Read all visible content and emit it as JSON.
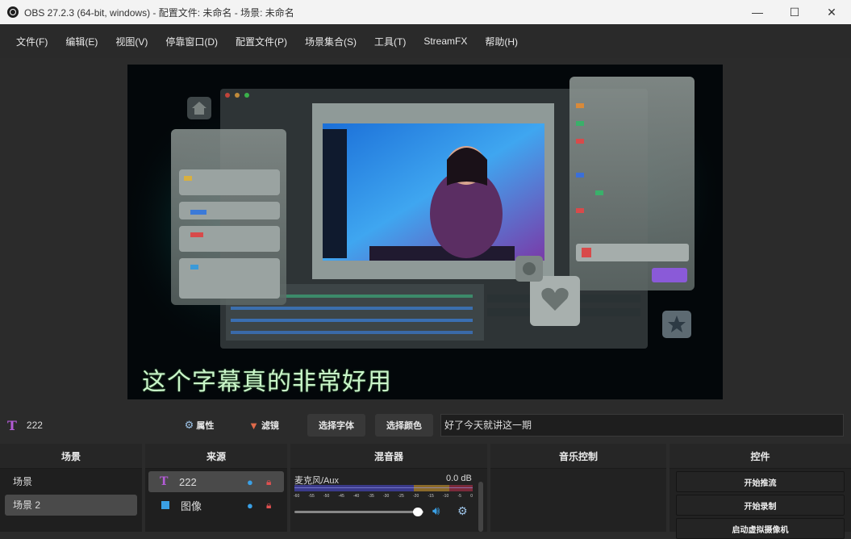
{
  "window": {
    "title": "OBS 27.2.3 (64-bit, windows) - 配置文件: 未命名 - 场景: 未命名",
    "minimize": "—",
    "maximize": "☐",
    "close": "✕"
  },
  "menu": [
    "文件(F)",
    "编辑(E)",
    "视图(V)",
    "停靠窗口(D)",
    "配置文件(P)",
    "场景集合(S)",
    "工具(T)",
    "StreamFX",
    "帮助(H)"
  ],
  "preview": {
    "subtitle": "这个字幕真的非常好用"
  },
  "properties_bar": {
    "source_name": "222",
    "properties_label": "属性",
    "filters_label": "滤镜",
    "select_font_label": "选择字体",
    "select_color_label": "选择颜色",
    "text_value": "好了今天就讲这一期"
  },
  "docks": {
    "scenes": {
      "title": "场景",
      "items": [
        "场景",
        "场景 2"
      ],
      "selected_index": 1
    },
    "sources": {
      "title": "来源",
      "items": [
        {
          "name": "222",
          "type": "text-icon"
        },
        {
          "name": "图像",
          "type": "image-icon"
        }
      ]
    },
    "mixer": {
      "title": "混音器",
      "channel_name": "麦克风/Aux",
      "level": "0.0 dB",
      "ticks": [
        "-60",
        "-55",
        "-50",
        "-45",
        "-40",
        "-35",
        "-30",
        "-25",
        "-20",
        "-15",
        "-10",
        "-5",
        "0"
      ],
      "volume": 1.0
    },
    "music": {
      "title": "音乐控制"
    },
    "controls": {
      "title": "控件",
      "buttons": [
        "开始推流",
        "开始录制",
        "启动虚拟摄像机"
      ]
    }
  },
  "colors": {
    "accent_purple": "#b35bd6",
    "lock_red": "#e05050",
    "eye_blue": "#3aa0e6"
  }
}
